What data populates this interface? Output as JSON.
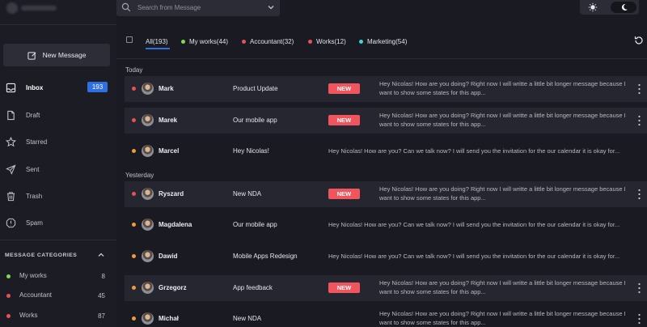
{
  "colors": {
    "accent_blue": "#2f6fe0",
    "new_badge": "#f0555e",
    "dot_red": "#e9505a",
    "dot_orange": "#f09a3e",
    "dot_green": "#7ed957",
    "dot_teal": "#43d1d6"
  },
  "sidebar": {
    "new_message_label": "New Message",
    "nav": [
      {
        "label": "Inbox",
        "badge": "193",
        "icon": "inbox-icon"
      },
      {
        "label": "Draft",
        "icon": "draft-icon"
      },
      {
        "label": "Starred",
        "icon": "star-icon"
      },
      {
        "label": "Sent",
        "icon": "send-icon"
      },
      {
        "label": "Trash",
        "icon": "trash-icon"
      },
      {
        "label": "Spam",
        "icon": "spam-icon"
      }
    ],
    "categories_title": "MESSAGE CATEGORIES",
    "categories": [
      {
        "label": "My works",
        "count": "8",
        "color": "#7ed957"
      },
      {
        "label": "Accountant",
        "count": "45",
        "color": "#e9505a"
      },
      {
        "label": "Works",
        "count": "87",
        "color": "#e9505a"
      }
    ]
  },
  "search": {
    "placeholder": "Search from Message"
  },
  "tabs": [
    {
      "label": "All(193)",
      "active": true
    },
    {
      "label": "My works(44)",
      "color": "#7ed957"
    },
    {
      "label": "Accountant(32)",
      "color": "#e9505a"
    },
    {
      "label": "Works(12)",
      "color": "#e9505a"
    },
    {
      "label": "Marketing(54)",
      "color": "#43d1d6"
    }
  ],
  "groups": [
    {
      "label": "Today"
    },
    {
      "label": "Yesterday"
    }
  ],
  "messages": [
    {
      "name": "Mark",
      "subject": "Product Update",
      "badge": "NEW",
      "preview": "Hey Nicolas! How are you doing? Right now I will writte a little bit longer message because I want to show some states for this app..."
    },
    {
      "name": "Marek",
      "subject": "Our mobile app",
      "badge": "NEW",
      "preview": "Hey Nicolas! How are you doing? Right now I will writte a little bit longer message because I want to show some states for this app..."
    },
    {
      "name": "Marcel",
      "subject": "Hey Nicolas!",
      "badge": "",
      "preview": "Hey Nicolas! How are you? Can we talk now? I will send you the invitation for the our calendar it is okay for..."
    },
    {
      "name": "Ryszard",
      "subject": "New NDA",
      "badge": "NEW",
      "preview": "Hey Nicolas! How are you doing? Right now I will writte a little bit longer message because I want to show some states for this app..."
    },
    {
      "name": "Magdalena",
      "subject": "Our mobile app",
      "badge": "",
      "preview": "Hey Nicolas! How are you? Can we talk now? I will send you the invitation for the our calendar it is okay for..."
    },
    {
      "name": "Dawid",
      "subject": "Mobile Apps Redesign",
      "badge": "",
      "preview": "Hey Nicolas! How are you? Can we talk now? I will send you the invitation for the our calendar it is okay for..."
    },
    {
      "name": "Grzegorz",
      "subject": "App feedback",
      "badge": "NEW",
      "preview": "Hey Nicolas! How are you doing? Right now I will writte a little bit longer message because I want to show some states for this app..."
    },
    {
      "name": "Michał",
      "subject": "New NDA",
      "badge": "",
      "preview": "Hey Nicolas! How are you doing? Right now I will writte a little bit longer message because I want to show some states for this app..."
    }
  ]
}
